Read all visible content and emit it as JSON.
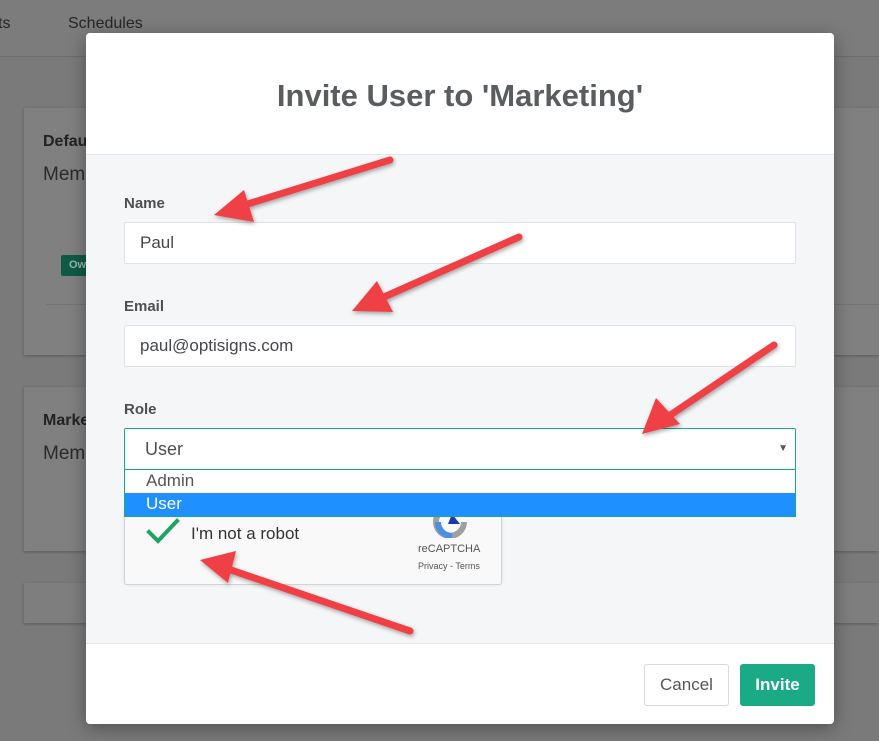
{
  "background": {
    "nav": [
      "ts",
      "Schedules"
    ],
    "cards": [
      {
        "title": "Defau",
        "subtitle": "Mem",
        "badge": "Ow"
      },
      {
        "title": "Marke",
        "subtitle": "Mem"
      }
    ]
  },
  "modal": {
    "title": "Invite User to 'Marketing'",
    "name": {
      "label": "Name",
      "value": "Paul"
    },
    "email": {
      "label": "Email",
      "value": "paul@optisigns.com"
    },
    "role": {
      "label": "Role",
      "selected": "User",
      "options": [
        "Admin",
        "User"
      ]
    },
    "recaptcha": {
      "label": "I'm not a robot",
      "brand": "reCAPTCHA",
      "links": "Privacy - Terms",
      "checked": true
    },
    "footer": {
      "cancel_label": "Cancel",
      "invite_label": "Invite"
    }
  },
  "colors": {
    "accent": "#1aab86",
    "selected_option": "#1e90ff",
    "annotation_arrow": "#ef3f45"
  }
}
